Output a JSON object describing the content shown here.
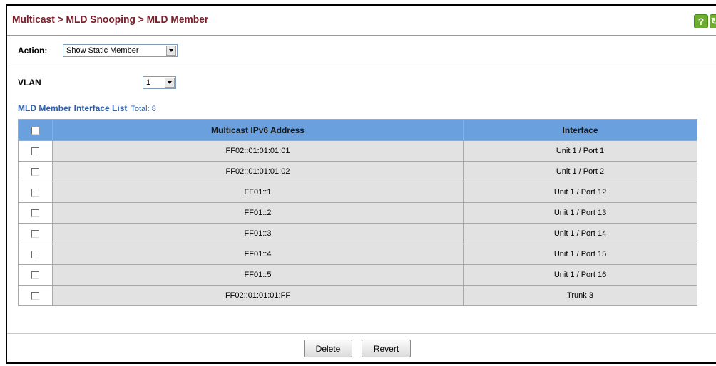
{
  "header": {
    "title": "Multicast > MLD Snooping > MLD Member",
    "help_icon": "question-mark-icon",
    "refresh_icon": "refresh-icon",
    "icon_color": "#6cae2e"
  },
  "action": {
    "label": "Action:",
    "selected": "Show Static Member"
  },
  "vlan": {
    "label": "VLAN",
    "selected": "1"
  },
  "list": {
    "title": "MLD Member Interface List",
    "total": "Total: 8"
  },
  "table": {
    "columns": [
      "Multicast IPv6 Address",
      "Interface"
    ],
    "header_color": "#6aa0de",
    "rows": [
      {
        "address": "FF02::01:01:01:01",
        "interface": "Unit 1 / Port 1"
      },
      {
        "address": "FF02::01:01:01:02",
        "interface": "Unit 1 / Port 2"
      },
      {
        "address": "FF01::1",
        "interface": "Unit 1 / Port 12"
      },
      {
        "address": "FF01::2",
        "interface": "Unit 1 / Port 13"
      },
      {
        "address": "FF01::3",
        "interface": "Unit 1 / Port 14"
      },
      {
        "address": "FF01::4",
        "interface": "Unit 1 / Port 15"
      },
      {
        "address": "FF01::5",
        "interface": "Unit 1 / Port 16"
      },
      {
        "address": "FF02::01:01:01:FF",
        "interface": "Trunk 3"
      }
    ]
  },
  "buttons": {
    "delete": "Delete",
    "revert": "Revert"
  }
}
